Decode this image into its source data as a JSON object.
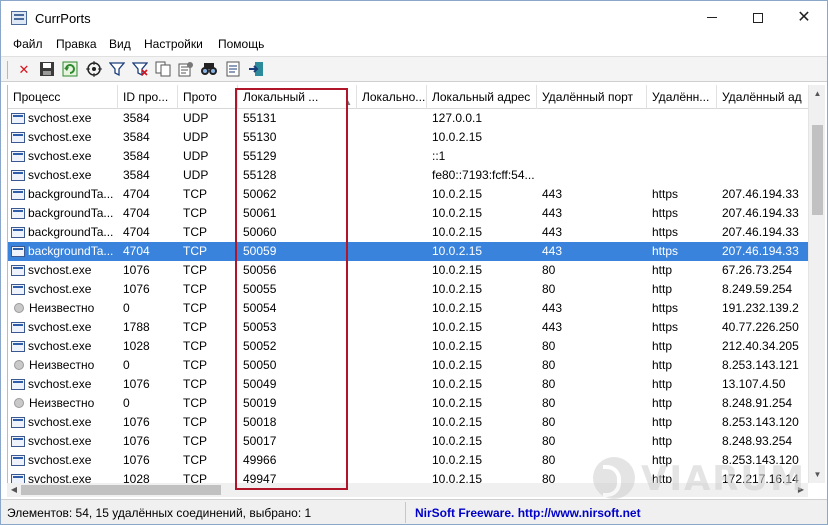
{
  "window": {
    "title": "CurrPorts"
  },
  "menu": [
    "Файл",
    "Правка",
    "Вид",
    "Настройки",
    "Помощь"
  ],
  "toolbar": {
    "icons": [
      "close-connection-icon",
      "save-icon",
      "refresh-icon",
      "target-icon",
      "filter-icon",
      "filter-clear-icon",
      "copy-icon",
      "properties-icon",
      "find-icon",
      "report-icon",
      "exit-icon"
    ]
  },
  "table": {
    "columns": [
      "Процесс",
      "ID про...",
      "Прото",
      "Локальный ...",
      "Локально...",
      "Локальный адрес",
      "Удалённый порт",
      "Удалённ...",
      "Удалённый ад"
    ],
    "rows": [
      {
        "icon": "proc",
        "process": "svchost.exe",
        "pid": "3584",
        "proto": "UDP",
        "lport": "55131",
        "lportname": "",
        "laddr": "127.0.0.1",
        "rport": "",
        "rportname": "",
        "raddr": ""
      },
      {
        "icon": "proc",
        "process": "svchost.exe",
        "pid": "3584",
        "proto": "UDP",
        "lport": "55130",
        "lportname": "",
        "laddr": "10.0.2.15",
        "rport": "",
        "rportname": "",
        "raddr": ""
      },
      {
        "icon": "proc",
        "process": "svchost.exe",
        "pid": "3584",
        "proto": "UDP",
        "lport": "55129",
        "lportname": "",
        "laddr": "::1",
        "rport": "",
        "rportname": "",
        "raddr": ""
      },
      {
        "icon": "proc",
        "process": "svchost.exe",
        "pid": "3584",
        "proto": "UDP",
        "lport": "55128",
        "lportname": "",
        "laddr": "fe80::7193:fcff:54...",
        "rport": "",
        "rportname": "",
        "raddr": ""
      },
      {
        "icon": "proc",
        "process": "backgroundTa...",
        "pid": "4704",
        "proto": "TCP",
        "lport": "50062",
        "lportname": "",
        "laddr": "10.0.2.15",
        "rport": "443",
        "rportname": "https",
        "raddr": "207.46.194.33"
      },
      {
        "icon": "proc",
        "process": "backgroundTa...",
        "pid": "4704",
        "proto": "TCP",
        "lport": "50061",
        "lportname": "",
        "laddr": "10.0.2.15",
        "rport": "443",
        "rportname": "https",
        "raddr": "207.46.194.33"
      },
      {
        "icon": "proc",
        "process": "backgroundTa...",
        "pid": "4704",
        "proto": "TCP",
        "lport": "50060",
        "lportname": "",
        "laddr": "10.0.2.15",
        "rport": "443",
        "rportname": "https",
        "raddr": "207.46.194.33"
      },
      {
        "icon": "proc",
        "process": "backgroundTa...",
        "pid": "4704",
        "proto": "TCP",
        "lport": "50059",
        "lportname": "",
        "laddr": "10.0.2.15",
        "rport": "443",
        "rportname": "https",
        "raddr": "207.46.194.33",
        "selected": true
      },
      {
        "icon": "proc",
        "process": "svchost.exe",
        "pid": "1076",
        "proto": "TCP",
        "lport": "50056",
        "lportname": "",
        "laddr": "10.0.2.15",
        "rport": "80",
        "rportname": "http",
        "raddr": "67.26.73.254"
      },
      {
        "icon": "proc",
        "process": "svchost.exe",
        "pid": "1076",
        "proto": "TCP",
        "lport": "50055",
        "lportname": "",
        "laddr": "10.0.2.15",
        "rport": "80",
        "rportname": "http",
        "raddr": "8.249.59.254"
      },
      {
        "icon": "unknown",
        "process": "Неизвестно",
        "pid": "0",
        "proto": "TCP",
        "lport": "50054",
        "lportname": "",
        "laddr": "10.0.2.15",
        "rport": "443",
        "rportname": "https",
        "raddr": "191.232.139.2"
      },
      {
        "icon": "proc",
        "process": "svchost.exe",
        "pid": "1788",
        "proto": "TCP",
        "lport": "50053",
        "lportname": "",
        "laddr": "10.0.2.15",
        "rport": "443",
        "rportname": "https",
        "raddr": "40.77.226.250"
      },
      {
        "icon": "proc",
        "process": "svchost.exe",
        "pid": "1028",
        "proto": "TCP",
        "lport": "50052",
        "lportname": "",
        "laddr": "10.0.2.15",
        "rport": "80",
        "rportname": "http",
        "raddr": "212.40.34.205"
      },
      {
        "icon": "unknown",
        "process": "Неизвестно",
        "pid": "0",
        "proto": "TCP",
        "lport": "50050",
        "lportname": "",
        "laddr": "10.0.2.15",
        "rport": "80",
        "rportname": "http",
        "raddr": "8.253.143.121"
      },
      {
        "icon": "proc",
        "process": "svchost.exe",
        "pid": "1076",
        "proto": "TCP",
        "lport": "50049",
        "lportname": "",
        "laddr": "10.0.2.15",
        "rport": "80",
        "rportname": "http",
        "raddr": "13.107.4.50"
      },
      {
        "icon": "unknown",
        "process": "Неизвестно",
        "pid": "0",
        "proto": "TCP",
        "lport": "50019",
        "lportname": "",
        "laddr": "10.0.2.15",
        "rport": "80",
        "rportname": "http",
        "raddr": "8.248.91.254"
      },
      {
        "icon": "proc",
        "process": "svchost.exe",
        "pid": "1076",
        "proto": "TCP",
        "lport": "50018",
        "lportname": "",
        "laddr": "10.0.2.15",
        "rport": "80",
        "rportname": "http",
        "raddr": "8.253.143.120"
      },
      {
        "icon": "proc",
        "process": "svchost.exe",
        "pid": "1076",
        "proto": "TCP",
        "lport": "50017",
        "lportname": "",
        "laddr": "10.0.2.15",
        "rport": "80",
        "rportname": "http",
        "raddr": "8.248.93.254"
      },
      {
        "icon": "proc",
        "process": "svchost.exe",
        "pid": "1076",
        "proto": "TCP",
        "lport": "49966",
        "lportname": "",
        "laddr": "10.0.2.15",
        "rport": "80",
        "rportname": "http",
        "raddr": "8.253.143.120"
      },
      {
        "icon": "proc",
        "process": "svchost.exe",
        "pid": "1028",
        "proto": "TCP",
        "lport": "49947",
        "lportname": "",
        "laddr": "10.0.2.15",
        "rport": "80",
        "rportname": "http",
        "raddr": "172.217.16.14"
      }
    ]
  },
  "status": {
    "summary": "Элементов: 54, 15 удалённых соединений, выбрано: 1",
    "link": "NirSoft Freeware.  http://www.nirsoft.net"
  },
  "watermark": {
    "text": "VIARUM"
  },
  "colors": {
    "selection": "#3a83dc",
    "highlight_box": "#b0152a",
    "link": "#0000c8"
  }
}
